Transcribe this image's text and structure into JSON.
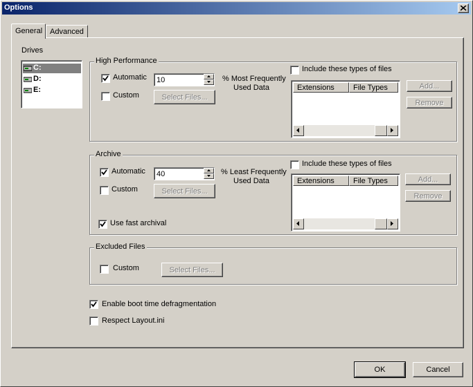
{
  "window": {
    "title": "Options"
  },
  "tabs": [
    {
      "label": "General",
      "active": true
    },
    {
      "label": "Advanced",
      "active": false
    }
  ],
  "drives": {
    "label": "Drives",
    "items": [
      {
        "label": "C:",
        "selected": true
      },
      {
        "label": "D:",
        "selected": false
      },
      {
        "label": "E:",
        "selected": false
      }
    ]
  },
  "high_performance": {
    "label": "High Performance",
    "automatic_label": "Automatic",
    "automatic_checked": true,
    "value": "10",
    "percent_label_line1": "% Most Frequently",
    "percent_label_line2": "Used Data",
    "custom_label": "Custom",
    "custom_checked": false,
    "select_files_label": "Select Files...",
    "include_label": "Include these types of files",
    "include_checked": false,
    "columns": [
      "Extensions",
      "File Types"
    ],
    "add_label": "Add...",
    "remove_label": "Remove"
  },
  "archive": {
    "label": "Archive",
    "automatic_label": "Automatic",
    "automatic_checked": true,
    "value": "40",
    "percent_label_line1": "% Least Frequently",
    "percent_label_line2": "Used Data",
    "custom_label": "Custom",
    "custom_checked": false,
    "select_files_label": "Select Files...",
    "fast_archival_label": "Use fast archival",
    "fast_archival_checked": true,
    "include_label": "Include these types of files",
    "include_checked": false,
    "columns": [
      "Extensions",
      "File Types"
    ],
    "add_label": "Add...",
    "remove_label": "Remove"
  },
  "excluded_files": {
    "label": "Excluded Files",
    "custom_label": "Custom",
    "custom_checked": false,
    "select_files_label": "Select Files..."
  },
  "options": {
    "boot_defrag_label": "Enable boot time defragmentation",
    "boot_defrag_checked": true,
    "respect_layout_label": "Respect Layout.ini",
    "respect_layout_checked": false
  },
  "buttons": {
    "ok": "OK",
    "cancel": "Cancel"
  },
  "colors": {
    "face": "#d4d0c8",
    "titlebar_start": "#0a246a",
    "titlebar_end": "#a6caf0",
    "selection": "#808080",
    "disabled_text": "#808080"
  }
}
